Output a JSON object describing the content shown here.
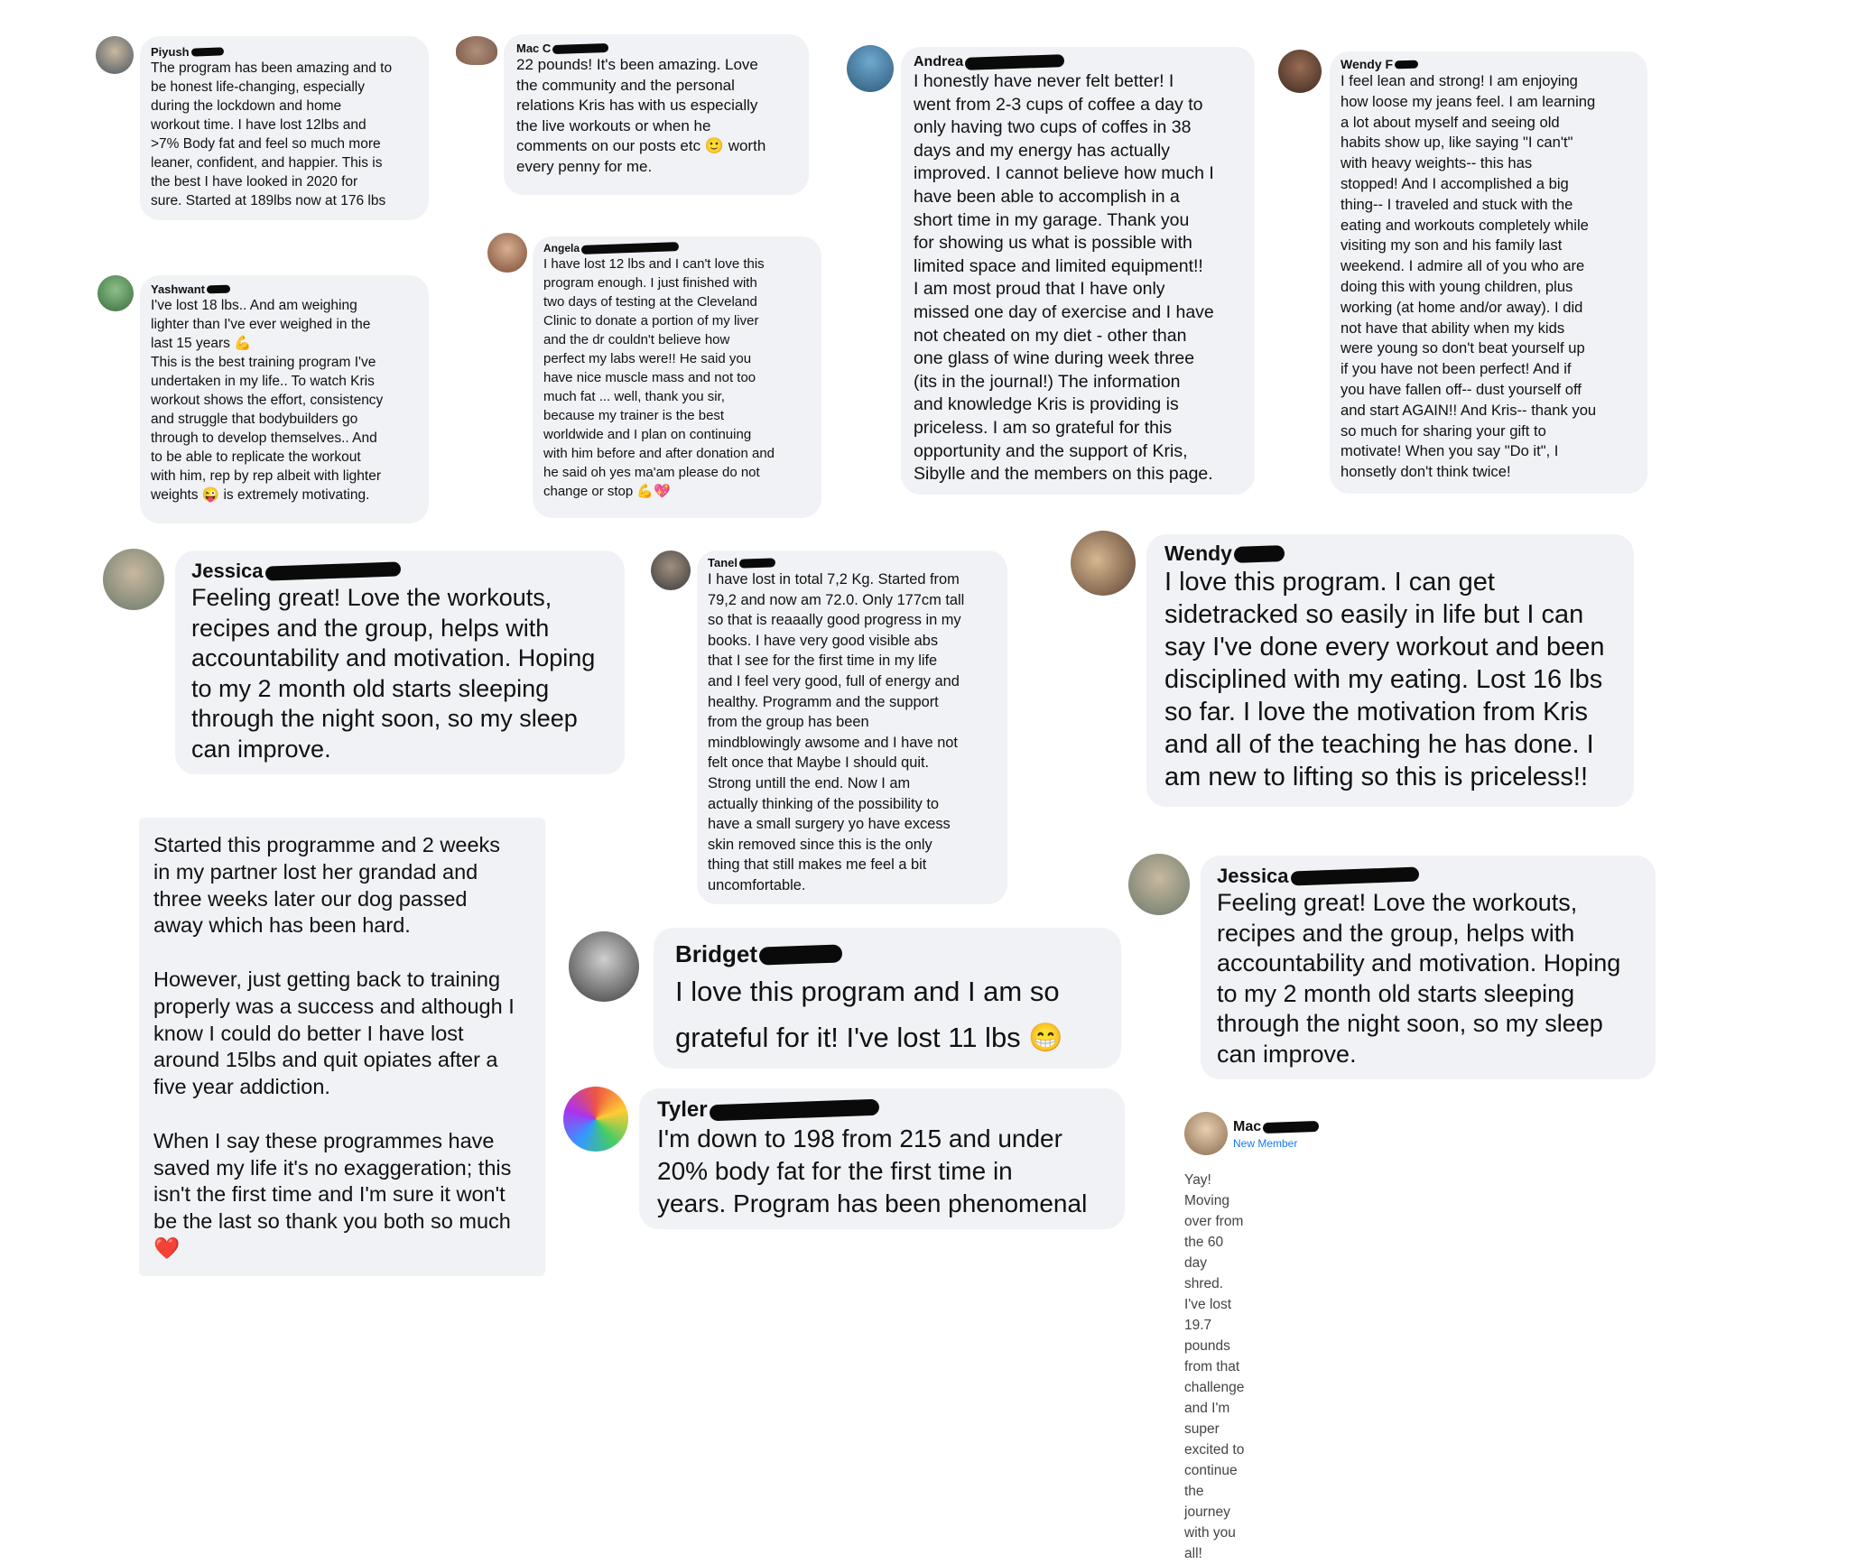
{
  "testimonials": [
    {
      "name": "Piyush",
      "text": "The program has been amazing and to\nbe honest life-changing, especially\nduring the lockdown and home\nworkout time. I have lost 12lbs and\n>7% Body fat and feel so much more\nleaner, confident, and happier.  This is\nthe best I have looked in 2020 for\nsure. Started at 189lbs now at 176 lbs"
    },
    {
      "name": "Mac C",
      "text": "22 pounds! It's been amazing. Love\nthe community and the personal\nrelations Kris has with us especially\nthe live workouts or when he\ncomments on our posts etc 🙂 worth\nevery penny for me."
    },
    {
      "name": "Andrea",
      "text": "I honestly have never felt better!  I\nwent from 2-3 cups of coffee a day to\nonly having two cups of coffes in 38\ndays and my energy has actually\nimproved.  I cannot believe how much I\nhave been able to accomplish in a\nshort time in my garage.  Thank you\nfor showing us what is possible with\nlimited space and limited equipment!!\nI am most proud that I have only\nmissed one day of exercise and I have\nnot cheated on my diet - other than\none glass of wine during week three\n(its in the journal!)  The information\nand knowledge Kris is providing is\npriceless.  I am so grateful for this\nopportunity and the support of Kris,\nSibylle and the members on this page."
    },
    {
      "name": "Wendy F",
      "text": "I feel lean and strong! I am enjoying\nhow loose my jeans feel. I am learning\na lot about myself and seeing old\nhabits show up, like saying \"I can't\"\nwith heavy weights-- this has\nstopped! And I accomplished a big\nthing-- I traveled and stuck with the\neating and workouts completely while\nvisiting my son and his family last\nweekend. I admire all of you who are\ndoing this with young children, plus\nworking (at home and/or away). I did\nnot have that ability when my kids\nwere young so don't beat yourself up\nif you have not been perfect! And if\nyou have fallen off-- dust yourself off\nand start AGAIN!! And Kris-- thank you\nso much for sharing your gift to\nmotivate! When you say \"Do it\", I\nhonsetly don't think twice!"
    },
    {
      "name": "Yashwant",
      "text": "I've lost 18 lbs.. And am weighing\nlighter than I've ever weighed in the\nlast 15 years 💪\nThis is the best training program I've\nundertaken in my life.. To watch Kris\nworkout shows the effort, consistency\nand struggle that bodybuilders go\nthrough to develop themselves.. And\nto be able to replicate the workout\nwith him, rep by rep albeit with lighter\nweights 😜 is extremely motivating."
    },
    {
      "name": "Angela",
      "text": "I have lost 12 lbs and I can't love this\nprogram enough. I just finished with\ntwo days of testing at the Cleveland\nClinic to donate a portion of my liver\nand the dr couldn't believe how\nperfect my labs were!! He said you\nhave nice muscle mass and not too\nmuch fat ... well, thank you sir,\nbecause my trainer is the best\nworldwide and I plan on continuing\nwith him before and after donation and\nhe said oh yes ma'am please do not\nchange or stop 💪💖"
    },
    {
      "name": "Jessica",
      "text": "Feeling great! Love the workouts,\nrecipes and the group, helps with\naccountability and motivation. Hoping\nto my 2 month old starts sleeping\nthrough the night soon, so my sleep\ncan improve."
    },
    {
      "name": "Tanel",
      "text": "I have lost in total 7,2 Kg. Started from\n79,2 and now am 72.0. Only 177cm tall\nso that is reaaally good progress in my\nbooks. I have very good visible abs\nthat I see for the first time in my life\nand I feel very good, full of energy and\nhealthy. Programm and the support\nfrom the group has been\nmindblowingly awsome and I have not\nfelt once that Maybe I should quit.\nStrong untill the end. Now I am\nactually thinking of the possibility to\nhave a small surgery yo have excess\nskin removed since this is the only\nthing that still makes me feel a bit\nuncomfortable."
    },
    {
      "name": "Wendy",
      "text": "I love this program. I can get\nsidetracked so easily in life but I can\nsay I've done every workout and been\ndisciplined with my eating. Lost 16 lbs\nso far. I love the motivation from Kris\nand all of the teaching he has done. I\nam new to lifting so this is priceless!!"
    },
    {
      "name": "",
      "text": "Started this programme and 2 weeks\nin my partner lost her grandad and\nthree weeks later our dog passed\naway which has been hard.\n\nHowever, just getting back to training\nproperly was a success and although I\nknow I could do better I have lost\naround 15lbs and quit opiates after a\nfive year addiction.\n\nWhen I say these programmes have\nsaved my life it's no exaggeration; this\nisn't the first time and I'm sure it won't\nbe the last so thank you both so much\n❤️"
    },
    {
      "name": "Bridget",
      "text": "I love this program and I am so\ngrateful for it! I've lost 11 lbs 😁"
    },
    {
      "name": "Tyler",
      "text": "I'm down to 198 from 215 and under\n20% body fat for the first time in\nyears. Program has been phenomenal"
    },
    {
      "name": "Jessica",
      "text": "Feeling great! Love the workouts,\nrecipes and the group, helps with\naccountability and motivation. Hoping\nto my 2 month old starts sleeping\nthrough the night soon, so my sleep\ncan improve."
    },
    {
      "name": "Mac",
      "sub": "New Member",
      "text": "Yay! Moving over from the 60 day shred. I've lost 19.7 pounds from that\nchallenge and I'm super excited to continue the journey  with you all!"
    }
  ],
  "colors": {
    "bubble": "#f0f2f5",
    "redaction": "#0a0a0a",
    "sub": "#1877f2"
  }
}
